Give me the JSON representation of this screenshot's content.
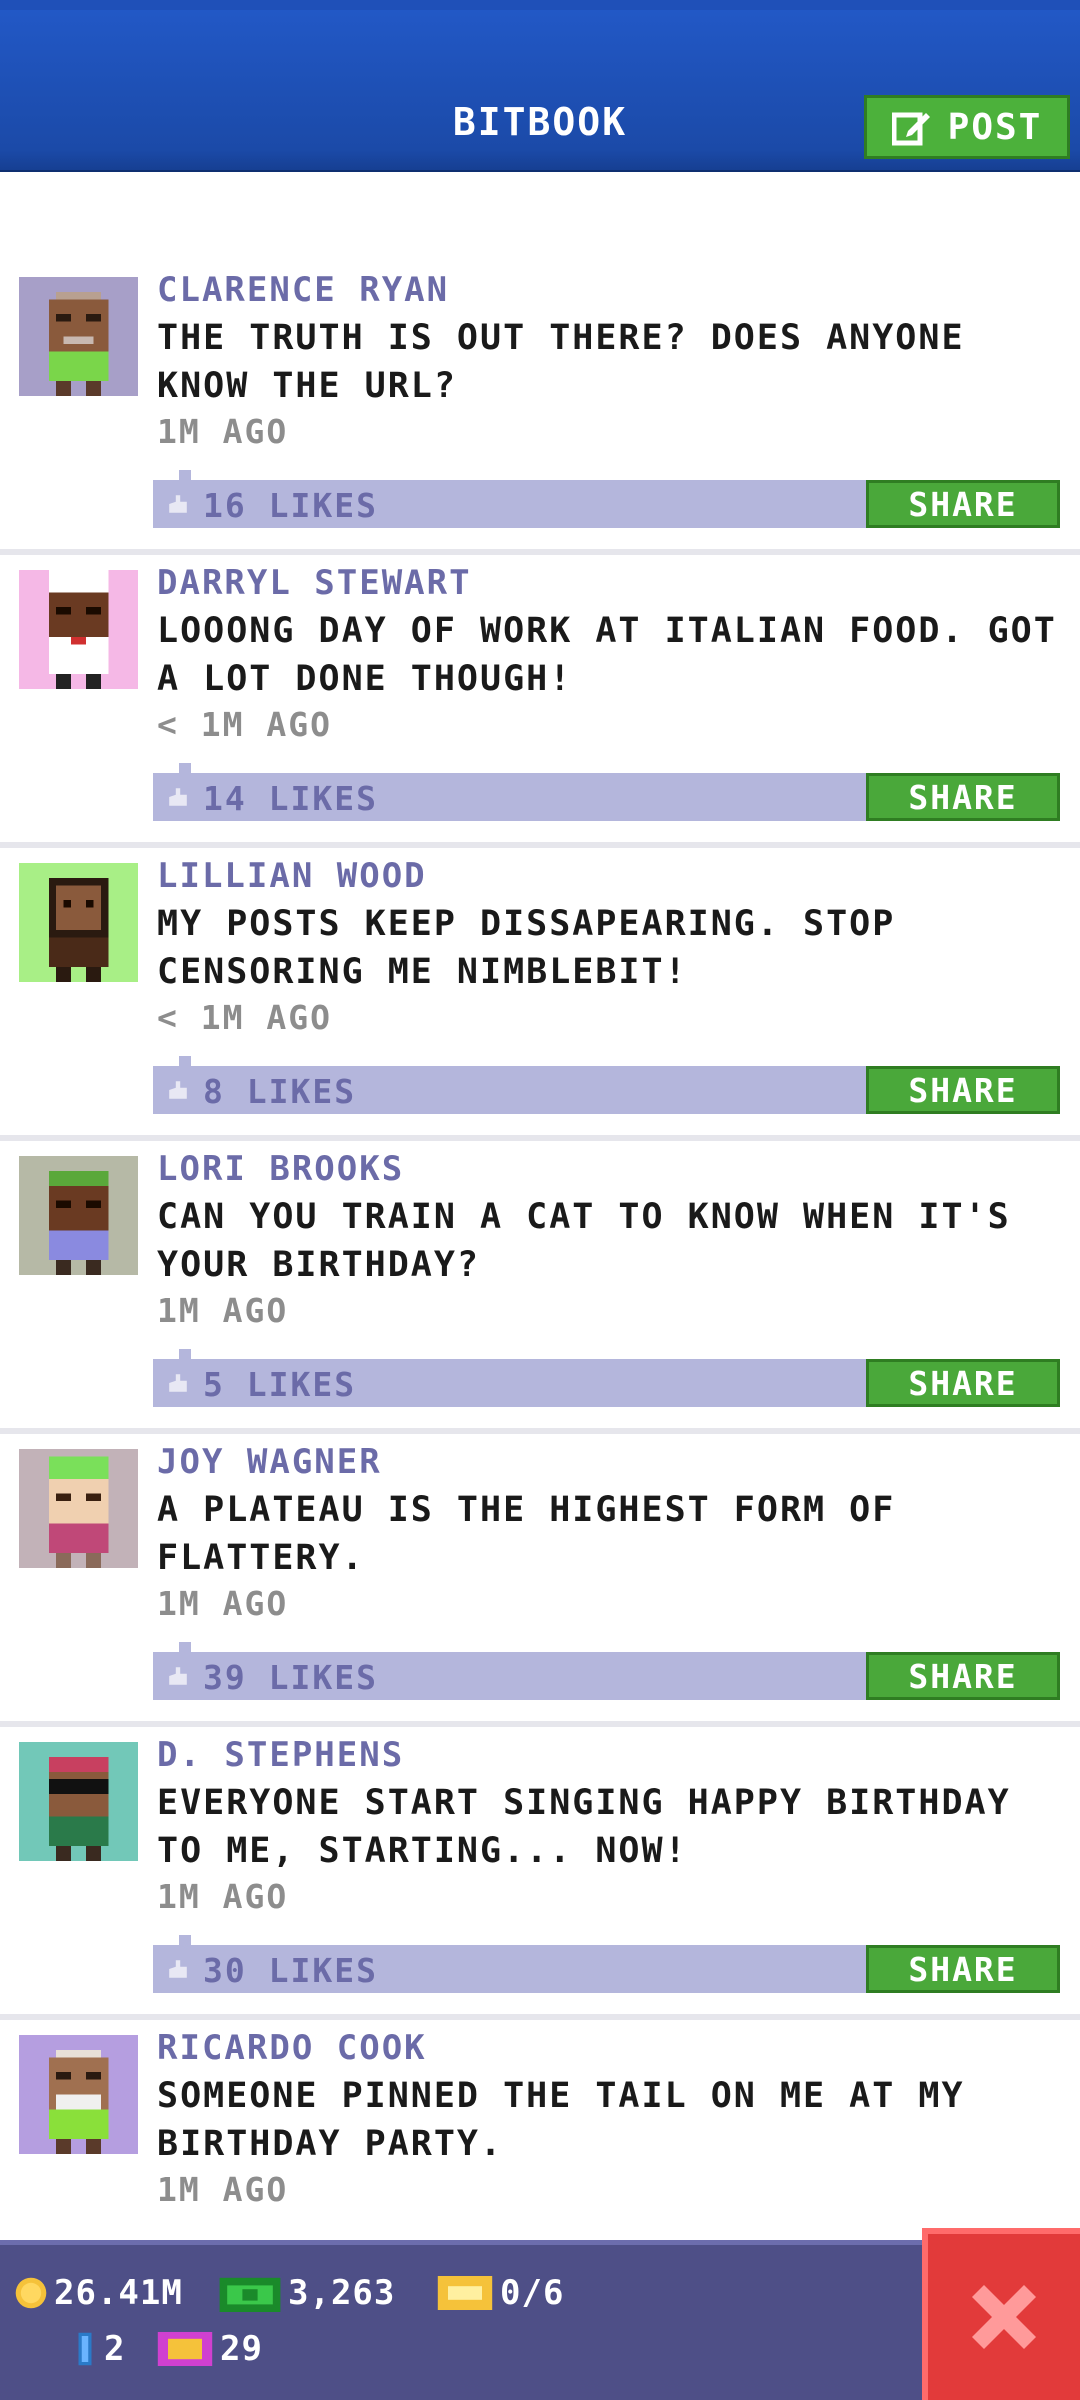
{
  "header": {
    "title": "BITBOOK",
    "post_label": "POST",
    "colors": {
      "bar": "#1b4aa8",
      "post_button": "#4cb13b"
    }
  },
  "posts": [
    {
      "author": "CLARENCE RYAN",
      "text": "THE TRUTH IS OUT THERE? DOES ANYONE KNOW THE URL?",
      "time": "1M AGO",
      "likes": "16 LIKES",
      "share": "SHARE",
      "avatar_bg": "#a79fc8",
      "avatar_icon": "bitizen-avatar"
    },
    {
      "author": "DARRYL STEWART",
      "text": "LOOONG DAY OF WORK AT ITALIAN FOOD. GOT A LOT DONE THOUGH!",
      "time": "< 1M AGO",
      "likes": "14 LIKES",
      "share": "SHARE",
      "avatar_bg": "#f5b8e6",
      "avatar_icon": "chef-avatar"
    },
    {
      "author": "LILLIAN WOOD",
      "text": "MY POSTS KEEP DISSAPEARING. STOP CENSORING ME NIMBLEBIT!",
      "time": "< 1M AGO",
      "likes": "8 LIKES",
      "share": "SHARE",
      "avatar_bg": "#a8ef86",
      "avatar_icon": "bitizen-avatar"
    },
    {
      "author": "LORI BROOKS",
      "text": "CAN YOU TRAIN A CAT TO KNOW WHEN IT'S YOUR BIRTHDAY?",
      "time": "1M AGO",
      "likes": "5 LIKES",
      "share": "SHARE",
      "avatar_bg": "#b6b9a6",
      "avatar_icon": "bitizen-avatar"
    },
    {
      "author": "JOY WAGNER",
      "text": "A PLATEAU IS THE HIGHEST FORM OF FLATTERY.",
      "time": "1M AGO",
      "likes": "39 LIKES",
      "share": "SHARE",
      "avatar_bg": "#c2b2b8",
      "avatar_icon": "bitizen-avatar"
    },
    {
      "author": "D. STEPHENS",
      "text": "EVERYONE START SINGING HAPPY BIRTHDAY TO ME, STARTING... NOW!",
      "time": "1M AGO",
      "likes": "30 LIKES",
      "share": "SHARE",
      "avatar_bg": "#72c8b8",
      "avatar_icon": "bitizen-avatar"
    },
    {
      "author": "RICARDO COOK",
      "text": "SOMEONE PINNED THE TAIL ON ME AT MY BIRTHDAY PARTY.",
      "time": "1M AGO",
      "likes": "",
      "share": "",
      "avatar_bg": "#b59ee0",
      "avatar_icon": "bitizen-avatar"
    }
  ],
  "status": {
    "coins": "26.41M",
    "bux": "3,263",
    "tickets": "0/6",
    "keys": "2",
    "vip": "29"
  },
  "close_icon": "close-x-icon"
}
